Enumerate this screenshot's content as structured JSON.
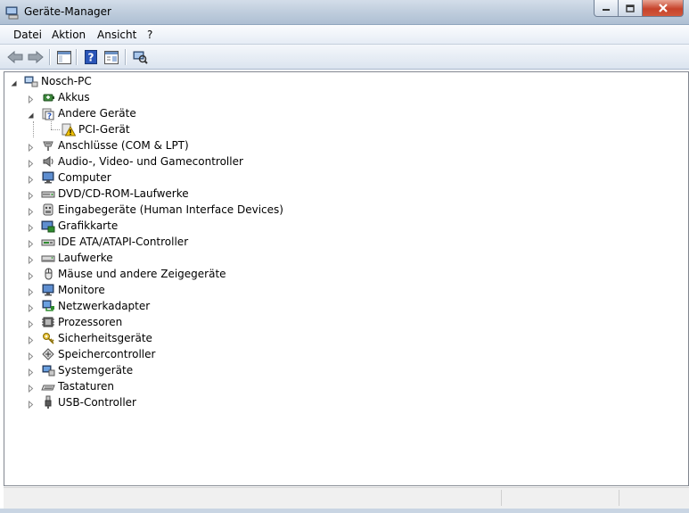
{
  "window": {
    "title": "Geräte-Manager"
  },
  "menu": {
    "items": [
      "Datei",
      "Aktion",
      "Ansicht",
      "?"
    ]
  },
  "toolbar": {
    "buttons": [
      {
        "icon": "back-arrow-icon"
      },
      {
        "icon": "forward-arrow-icon"
      },
      {
        "icon": "show-hide-console-tree-icon"
      },
      {
        "icon": "help-icon"
      },
      {
        "icon": "properties-icon"
      },
      {
        "icon": "scan-hardware-changes-icon"
      }
    ]
  },
  "tree": {
    "root": {
      "label": "Nosch-PC",
      "icon": "computer-icon",
      "expanded": true
    },
    "nodes": [
      {
        "label": "Akkus",
        "icon": "battery-icon",
        "expanded": false
      },
      {
        "label": "Andere Geräte",
        "icon": "unknown-device-icon",
        "expanded": true,
        "children": [
          {
            "label": "PCI-Gerät",
            "icon": "warning-device-icon"
          }
        ]
      },
      {
        "label": "Anschlüsse (COM & LPT)",
        "icon": "port-icon",
        "expanded": false
      },
      {
        "label": "Audio-, Video- und Gamecontroller",
        "icon": "speaker-icon",
        "expanded": false
      },
      {
        "label": "Computer",
        "icon": "monitor-icon",
        "expanded": false
      },
      {
        "label": "DVD/CD-ROM-Laufwerke",
        "icon": "optical-drive-icon",
        "expanded": false
      },
      {
        "label": "Eingabegeräte (Human Interface Devices)",
        "icon": "hid-icon",
        "expanded": false
      },
      {
        "label": "Grafikkarte",
        "icon": "display-adapter-icon",
        "expanded": false
      },
      {
        "label": "IDE ATA/ATAPI-Controller",
        "icon": "ide-controller-icon",
        "expanded": false
      },
      {
        "label": "Laufwerke",
        "icon": "disk-drive-icon",
        "expanded": false
      },
      {
        "label": "Mäuse und andere Zeigegeräte",
        "icon": "mouse-icon",
        "expanded": false
      },
      {
        "label": "Monitore",
        "icon": "monitor-icon",
        "expanded": false
      },
      {
        "label": "Netzwerkadapter",
        "icon": "network-adapter-icon",
        "expanded": false
      },
      {
        "label": "Prozessoren",
        "icon": "processor-icon",
        "expanded": false
      },
      {
        "label": "Sicherheitsgeräte",
        "icon": "security-device-icon",
        "expanded": false
      },
      {
        "label": "Speichercontroller",
        "icon": "storage-controller-icon",
        "expanded": false
      },
      {
        "label": "Systemgeräte",
        "icon": "system-device-icon",
        "expanded": false
      },
      {
        "label": "Tastaturen",
        "icon": "keyboard-icon",
        "expanded": false
      },
      {
        "label": "USB-Controller",
        "icon": "usb-icon",
        "expanded": false
      }
    ]
  },
  "colors": {
    "warning": "#f2c200",
    "selection": "#3399ff"
  }
}
